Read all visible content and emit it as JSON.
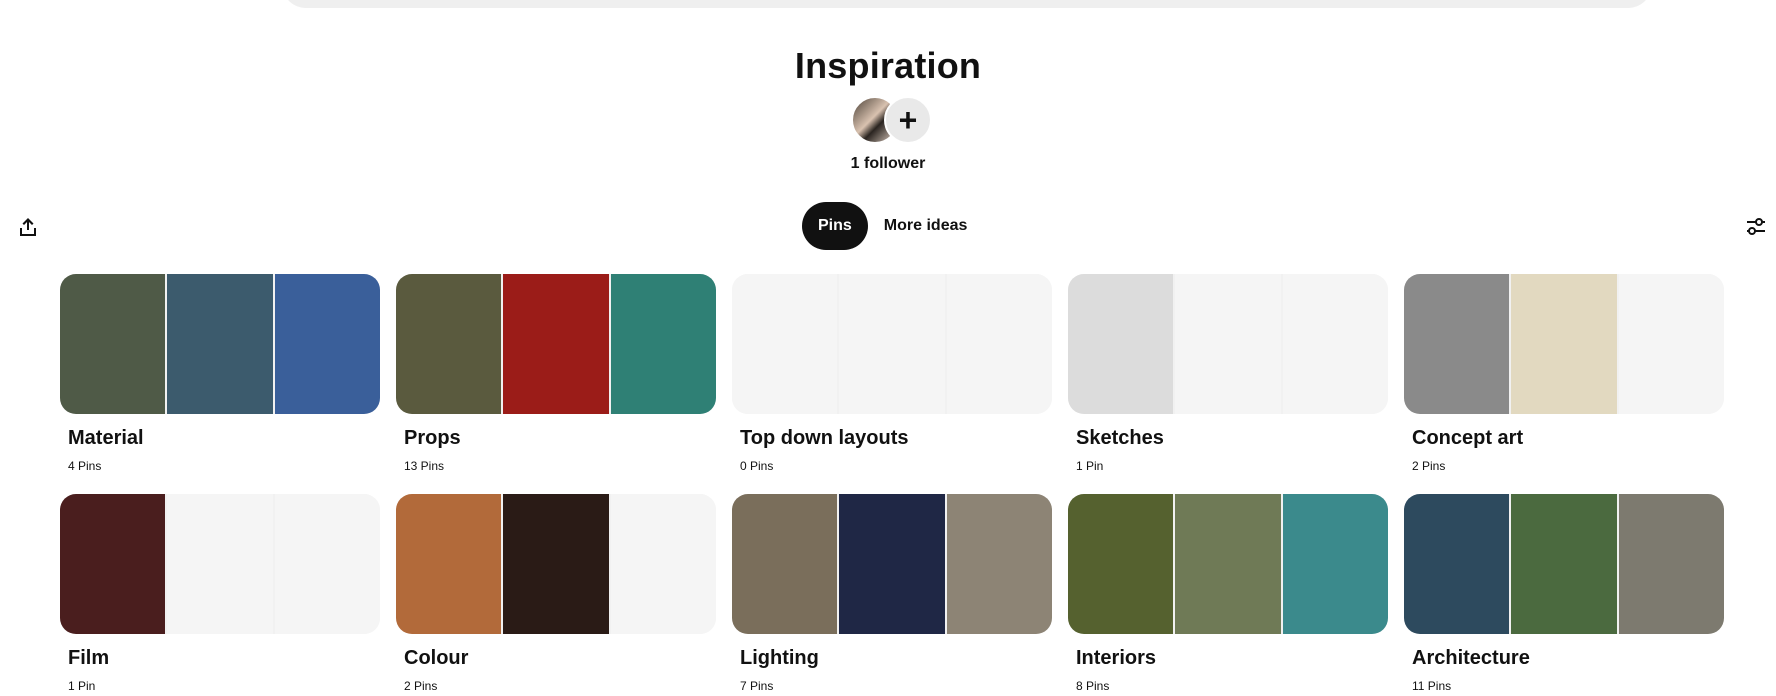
{
  "board": {
    "title": "Inspiration",
    "followers": "1 follower",
    "add_collaborator": "+"
  },
  "tabs": [
    {
      "label": "Pins",
      "active": true
    },
    {
      "label": "More ideas",
      "active": false
    }
  ],
  "icons": {
    "share": "share-icon",
    "filter": "filter-icon"
  },
  "sections": [
    {
      "name": "Material",
      "count": "4 Pins",
      "covers": [
        "#4f5a47",
        "#3c5b6d",
        "#3a5f9a"
      ]
    },
    {
      "name": "Props",
      "count": "13 Pins",
      "covers": [
        "#5a5a3e",
        "#9b1c18",
        "#2f8075"
      ]
    },
    {
      "name": "Top down layouts",
      "count": "0 Pins",
      "covers": [
        "#f5f5f5",
        "#f5f5f5",
        "#f5f5f5"
      ]
    },
    {
      "name": "Sketches",
      "count": "1 Pin",
      "covers": [
        "#dcdcdc",
        "#f5f5f5",
        "#f5f5f5"
      ]
    },
    {
      "name": "Concept art",
      "count": "2 Pins",
      "covers": [
        "#8a8a8a",
        "#e2d9c0",
        "#f5f5f5"
      ]
    },
    {
      "name": "Film",
      "count": "1 Pin",
      "covers": [
        "#4a1e1e",
        "#f5f5f5",
        "#f5f5f5"
      ]
    },
    {
      "name": "Colour",
      "count": "2 Pins",
      "covers": [
        "#b26a3a",
        "#2a1b16",
        "#f5f5f5"
      ]
    },
    {
      "name": "Lighting",
      "count": "7 Pins",
      "covers": [
        "#7a6e5b",
        "#1f2745",
        "#8d8475"
      ]
    },
    {
      "name": "Interiors",
      "count": "8 Pins",
      "covers": [
        "#55612f",
        "#6f7a56",
        "#3b8a8c"
      ]
    },
    {
      "name": "Architecture",
      "count": "11 Pins",
      "covers": [
        "#2d4a5e",
        "#4b6a3f",
        "#7d7a6f"
      ]
    }
  ]
}
